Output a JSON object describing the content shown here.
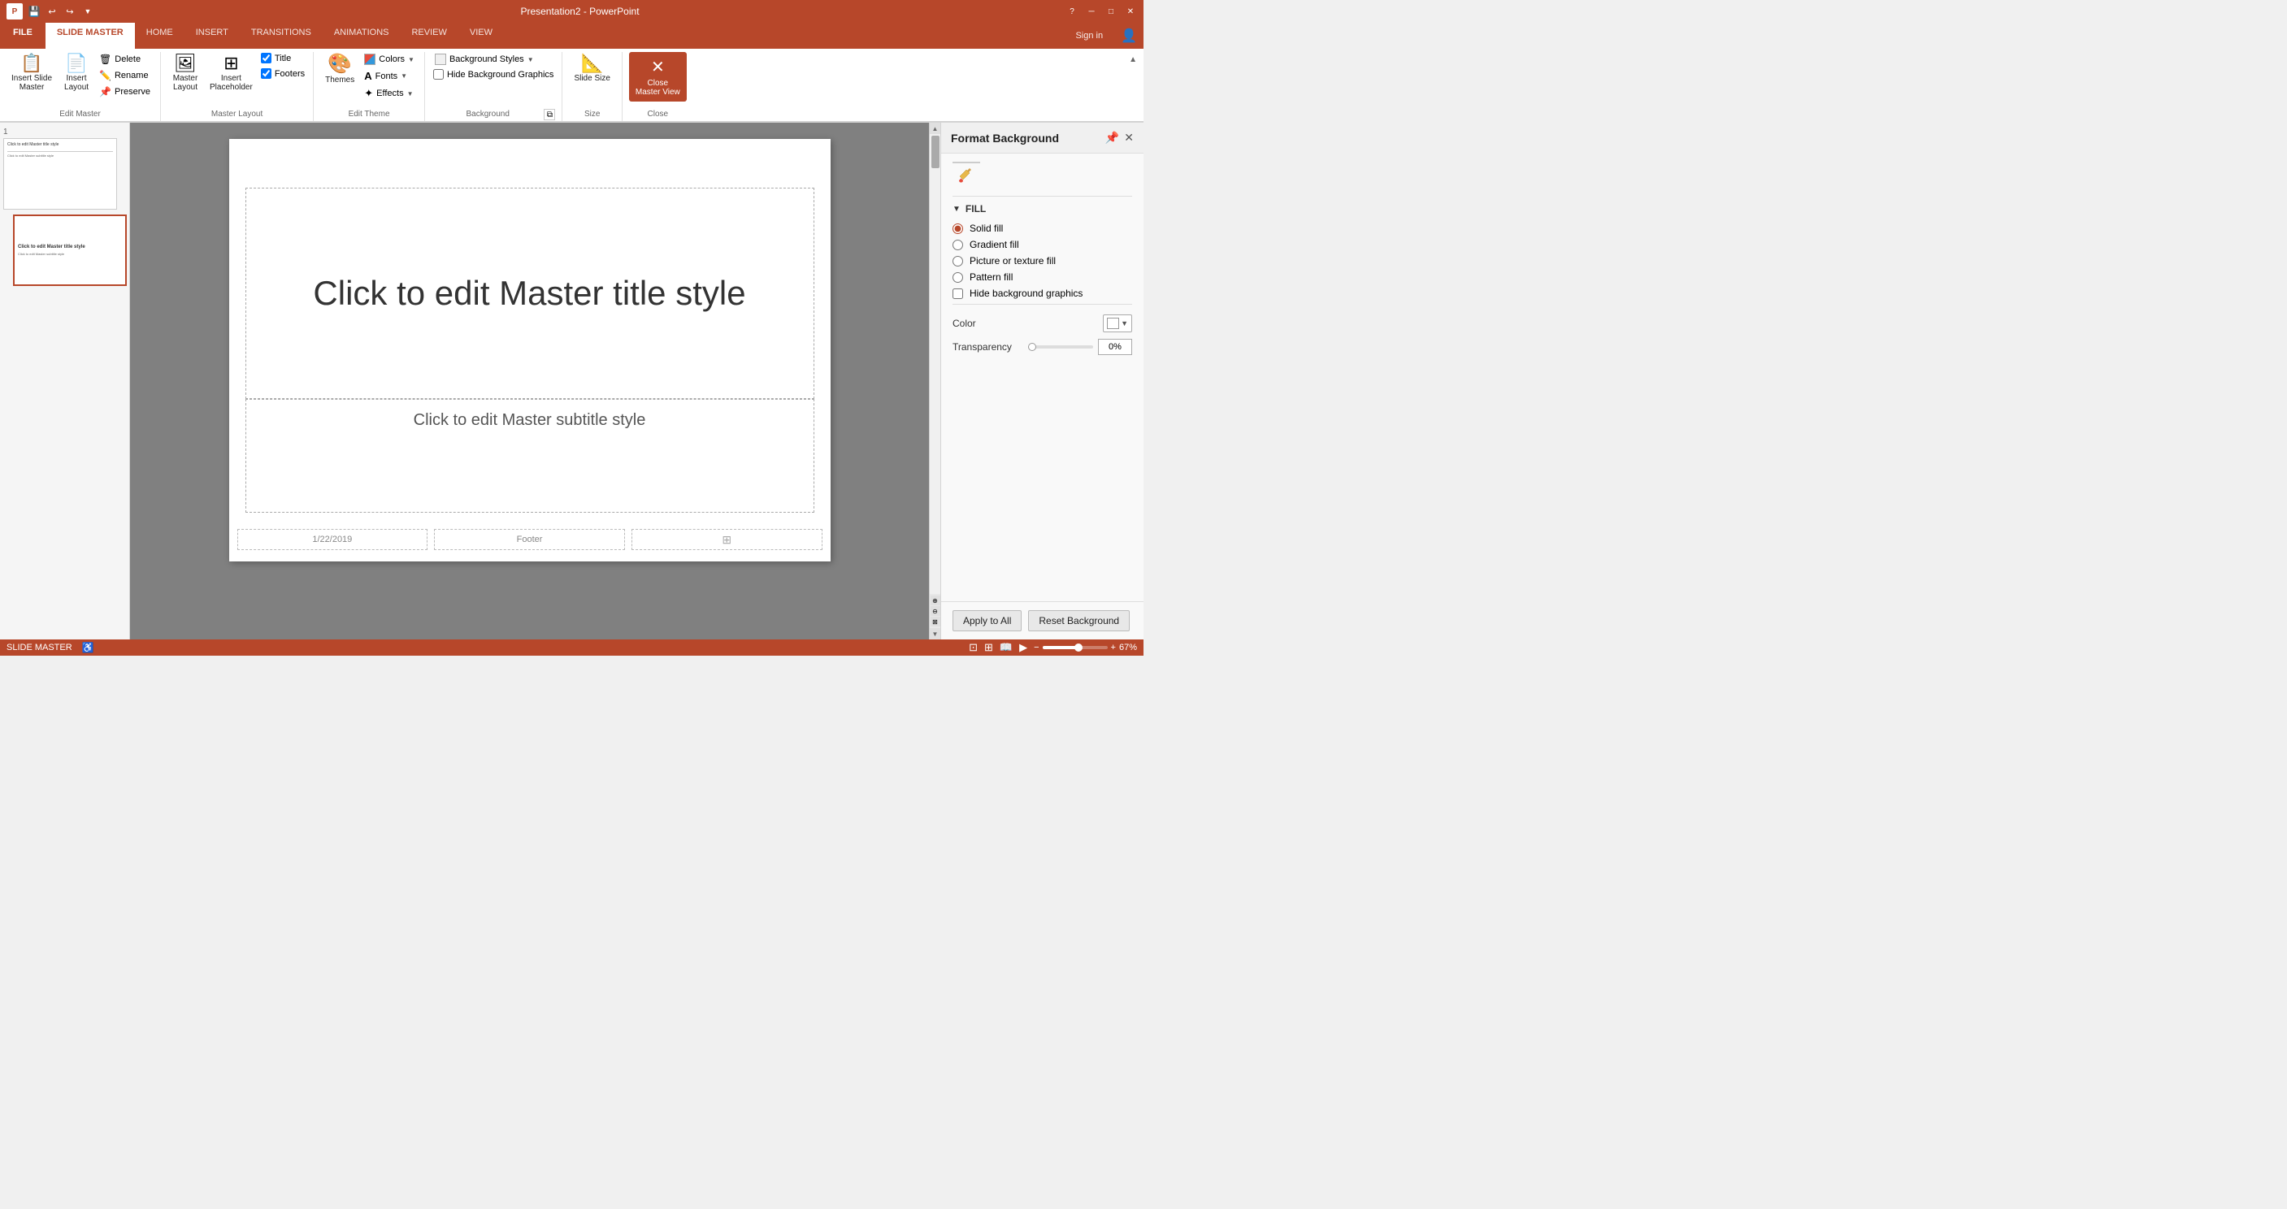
{
  "titleBar": {
    "appName": "Presentation2 - PowerPoint",
    "logoText": "P",
    "undoBtn": "↩",
    "redoBtn": "↪",
    "helpBtn": "?",
    "minimizeBtn": "─",
    "maximizeBtn": "□",
    "closeBtn": "✕"
  },
  "ribbonTabs": {
    "file": "FILE",
    "tabs": [
      "SLIDE MASTER",
      "HOME",
      "INSERT",
      "TRANSITIONS",
      "ANIMATIONS",
      "REVIEW",
      "VIEW"
    ],
    "activeTab": "SLIDE MASTER",
    "signIn": "Sign in"
  },
  "groups": {
    "editMaster": {
      "label": "Edit Master",
      "insertSlideMaster": "Insert Slide\nMaster",
      "insertLayout": "Insert\nLayout",
      "delete": "Delete",
      "rename": "Rename",
      "preserve": "Preserve"
    },
    "masterLayout": {
      "label": "Master Layout",
      "masterLayout": "Master\nLayout",
      "insertPlaceholder": "Insert\nPlaceholder",
      "title": "Title",
      "footers": "Footers"
    },
    "editTheme": {
      "label": "Edit Theme",
      "themes": "Themes",
      "colors": "Colors",
      "fonts": "Fonts",
      "effects": "Effects"
    },
    "background": {
      "label": "Background",
      "backgroundStyles": "Background Styles",
      "hideBackgroundGraphics": "Hide Background Graphics",
      "dialogBtn": "⧉"
    },
    "size": {
      "label": "Size",
      "slideSize": "Slide\nSize"
    },
    "close": {
      "label": "Close",
      "closeMasterView": "Close\nMaster View"
    }
  },
  "slidesPanel": {
    "slide1": {
      "num": "1",
      "titleText": "Click to edit Master title style",
      "subText": "Click to edit Master subtitle style"
    },
    "slide2": {
      "titleText": "Click to edit Master title style",
      "subText": "Click to edit Master subtitle style"
    }
  },
  "canvas": {
    "titlePlaceholder": "Click to edit Master title style",
    "subtitlePlaceholder": "Click to edit Master subtitle style",
    "date": "1/22/2019",
    "footer": "Footer",
    "pageNum": "⊞"
  },
  "formatPanel": {
    "title": "Format Background",
    "fillSection": "FILL",
    "options": {
      "solidFill": "Solid fill",
      "gradientFill": "Gradient fill",
      "pictureOrTextureFill": "Picture or texture fill",
      "patternFill": "Pattern fill",
      "hideBackgroundGraphics": "Hide background graphics"
    },
    "colorLabel": "Color",
    "transparencyLabel": "Transparency",
    "transparencyValue": "0%",
    "applyToAll": "Apply to All",
    "resetBackground": "Reset Background"
  },
  "statusBar": {
    "mode": "SLIDE MASTER",
    "viewIcon": "⊞",
    "zoomLevel": "67%",
    "zoomIn": "+",
    "zoomOut": "-"
  }
}
